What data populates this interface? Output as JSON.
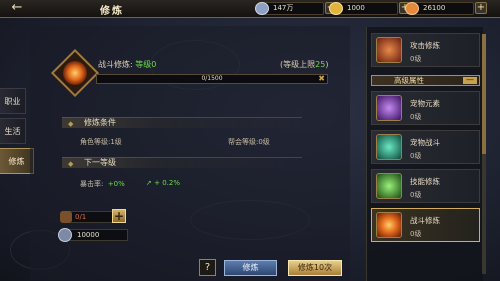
{
  "header": {
    "title": "修炼",
    "back_icon": "back-arrow-icon",
    "resources": [
      {
        "name": "silver",
        "icon": "silver-coin-icon",
        "value": "147万",
        "color": "#8ea0c4"
      },
      {
        "name": "gold",
        "icon": "gold-ingot-icon",
        "value": "1000",
        "color": "#e3b43c"
      },
      {
        "name": "food",
        "icon": "food-icon",
        "value": "26100",
        "color": "#e58a3a"
      }
    ]
  },
  "left_tabs": [
    {
      "label": "职业",
      "active": false
    },
    {
      "label": "生活",
      "active": false
    },
    {
      "label": "修炼",
      "active": true
    }
  ],
  "skill": {
    "name_prefix": "战斗修炼: ",
    "level_text": "等级0",
    "upper_limit_prefix": "(等级上限",
    "upper_limit_value": "25",
    "upper_limit_suffix": ")",
    "progress_text": "0/1500",
    "progress_fraction": 0.0
  },
  "conditions": {
    "header": "修炼条件",
    "role_level": "角色等级:1级",
    "guild_level": "帮会等级:0级"
  },
  "next_level": {
    "header": "下一等级",
    "stat_label": "暴击率:",
    "stat_value": "+0%",
    "stat_bonus": "+ 0.2%"
  },
  "costs": {
    "item_value": "0/1",
    "coin_value": "10000"
  },
  "buttons": {
    "help": "?",
    "train": "修炼",
    "train_ten": "修炼10次"
  },
  "right_list": {
    "items_top": [
      {
        "name": "攻击修炼",
        "level": "0级",
        "icon_color": "#b24a2a"
      }
    ],
    "group_header": "高级属性",
    "group_toggle": "—",
    "items_group": [
      {
        "name": "宠物元素",
        "level": "0级",
        "icon_color": "#8a4ad4"
      },
      {
        "name": "宠物战斗",
        "level": "0级",
        "icon_color": "#2aa88a"
      },
      {
        "name": "技能修炼",
        "level": "0级",
        "icon_color": "#4ac44a"
      },
      {
        "name": "战斗修炼",
        "level": "0级",
        "icon_color": "#d4741c",
        "selected": true
      }
    ]
  }
}
